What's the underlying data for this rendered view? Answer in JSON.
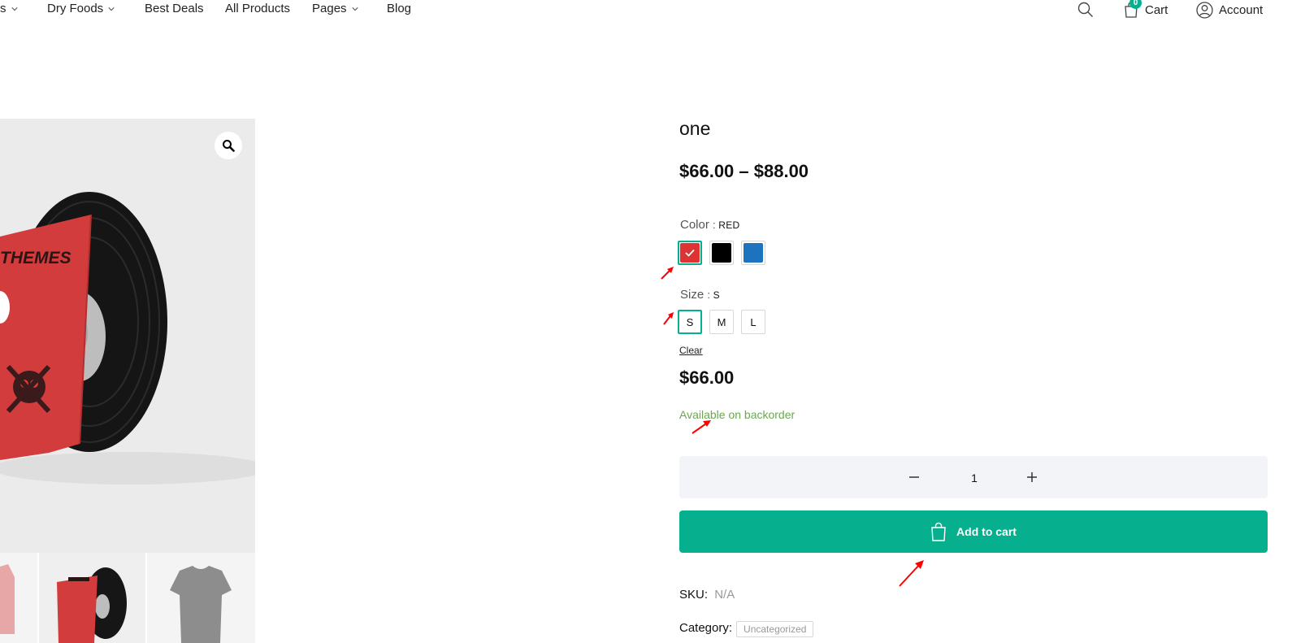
{
  "nav": {
    "items": [
      {
        "label": "s",
        "has_dropdown": true
      },
      {
        "label": "Dry Foods",
        "has_dropdown": true
      },
      {
        "label": "Best Deals",
        "has_dropdown": false
      },
      {
        "label": "All Products",
        "has_dropdown": false
      },
      {
        "label": "Pages",
        "has_dropdown": true
      },
      {
        "label": "Blog",
        "has_dropdown": false
      }
    ],
    "cart_label": "Cart",
    "cart_count": "0",
    "account_label": "Account"
  },
  "product": {
    "title": "one",
    "price_range": "$66.00 – $88.00",
    "color_label": "Color",
    "color_value": "RED",
    "colors": [
      {
        "name": "red",
        "hex": "#dd3333",
        "selected": true
      },
      {
        "name": "black",
        "hex": "#000000",
        "selected": false
      },
      {
        "name": "blue",
        "hex": "#1e73be",
        "selected": false
      }
    ],
    "size_label": "Size",
    "size_value": "S",
    "sizes": [
      {
        "label": "S",
        "selected": true
      },
      {
        "label": "M",
        "selected": false
      },
      {
        "label": "L",
        "selected": false
      }
    ],
    "clear_label": "Clear",
    "variation_price": "$66.00",
    "stock_status": "Available on backorder",
    "quantity": "1",
    "add_to_cart_label": "Add to cart",
    "sku_label": "SKU:",
    "sku_value": "N/A",
    "category_label": "Category:",
    "category_value": "Uncategorized"
  },
  "gallery": {
    "cover_text": "THEMES"
  },
  "colors": {
    "accent": "#06b08e",
    "stock": "#6aa84f",
    "qty_bg": "#f3f4f7",
    "gallery_bg": "#ebebeb",
    "annotation": "#ff0000"
  },
  "icons": [
    "chevron-down-icon",
    "search-icon",
    "cart-icon",
    "account-icon",
    "zoom-icon",
    "check-icon",
    "minus-icon",
    "plus-icon",
    "bag-icon"
  ]
}
